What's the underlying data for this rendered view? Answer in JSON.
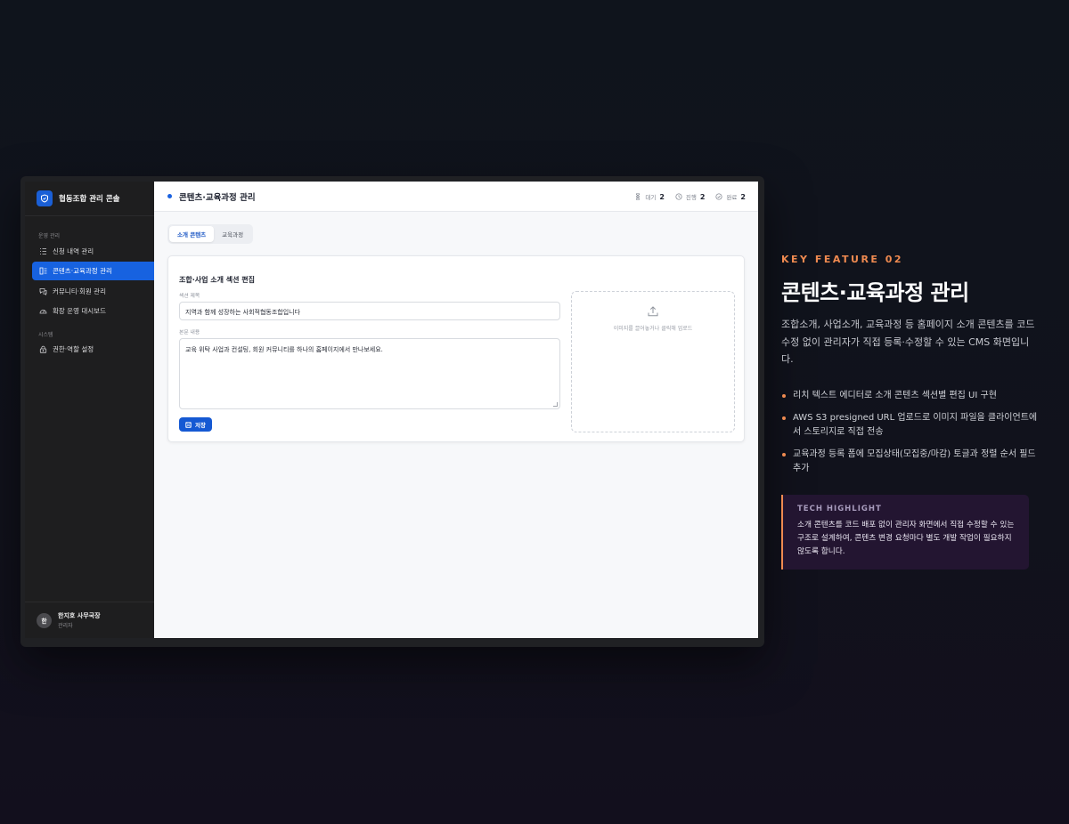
{
  "app": {
    "brand_name": "협동조합 관리 콘솔",
    "nav": {
      "section_ops": "운영 관리",
      "items": [
        {
          "label": "신청 내역 관리",
          "icon": "list-icon"
        },
        {
          "label": "콘텐츠·교육과정 관리",
          "icon": "document-icon"
        },
        {
          "label": "커뮤니티·회원 관리",
          "icon": "chat-icon"
        },
        {
          "label": "확장 운영 대시보드",
          "icon": "gauge-icon"
        }
      ],
      "section_system": "시스템",
      "system_items": [
        {
          "label": "권한·역할 설정",
          "icon": "lock-icon"
        }
      ]
    },
    "user": {
      "avatar": "한",
      "name": "한지호 사무국장",
      "role": "관리자"
    },
    "page_title": "콘텐츠·교육과정 관리",
    "stats": [
      {
        "label": "대기",
        "value": "2",
        "icon": "hourglass-icon"
      },
      {
        "label": "진행",
        "value": "2",
        "icon": "clock-icon"
      },
      {
        "label": "완료",
        "value": "2",
        "icon": "check-circle-icon"
      }
    ],
    "tabs": [
      "소개 콘텐츠",
      "교육과정"
    ],
    "active_tab": "소개 콘텐츠",
    "form": {
      "title": "조합·사업 소개 섹션 편집",
      "section_title_label": "섹션 제목",
      "section_title_value": "지역과 함께 성장하는 사회적협동조합입니다",
      "body_label": "본문 내용",
      "body_value": "교육 위탁 사업과 컨설팅, 회원 커뮤니티를 하나의 홈페이지에서 만나보세요.",
      "save_label": "저장",
      "upload_text": "이미지를 끌어놓거나 클릭해 업로드"
    }
  },
  "feature": {
    "kicker": "KEY FEATURE 02",
    "title": "콘텐츠·교육과정 관리",
    "description": "조합소개, 사업소개, 교육과정 등 홈페이지 소개 콘텐츠를 코드 수정 없이 관리자가 직접 등록·수정할 수 있는 CMS 화면입니다.",
    "bullets": [
      "리치 텍스트 에디터로 소개 콘텐츠 섹션별 편집 UI 구현",
      "AWS S3 presigned URL 업로드로 이미지 파일을 클라이언트에서 스토리지로 직접 전송",
      "교육과정 등록 폼에 모집상태(모집중/마감) 토글과 정렬 순서 필드 추가"
    ],
    "tech_title": "TECH HIGHLIGHT",
    "tech_body": "소개 콘텐츠를 코드 배포 없이 관리자 화면에서 직접 수정할 수 있는 구조로 설계하여, 콘텐츠 변경 요청마다 별도 개발 작업이 필요하지 않도록 합니다."
  },
  "colors": {
    "accent_blue": "#1762e0",
    "accent_orange": "#ef8a50",
    "background": "#10131b",
    "tech_panel": "#231531"
  }
}
